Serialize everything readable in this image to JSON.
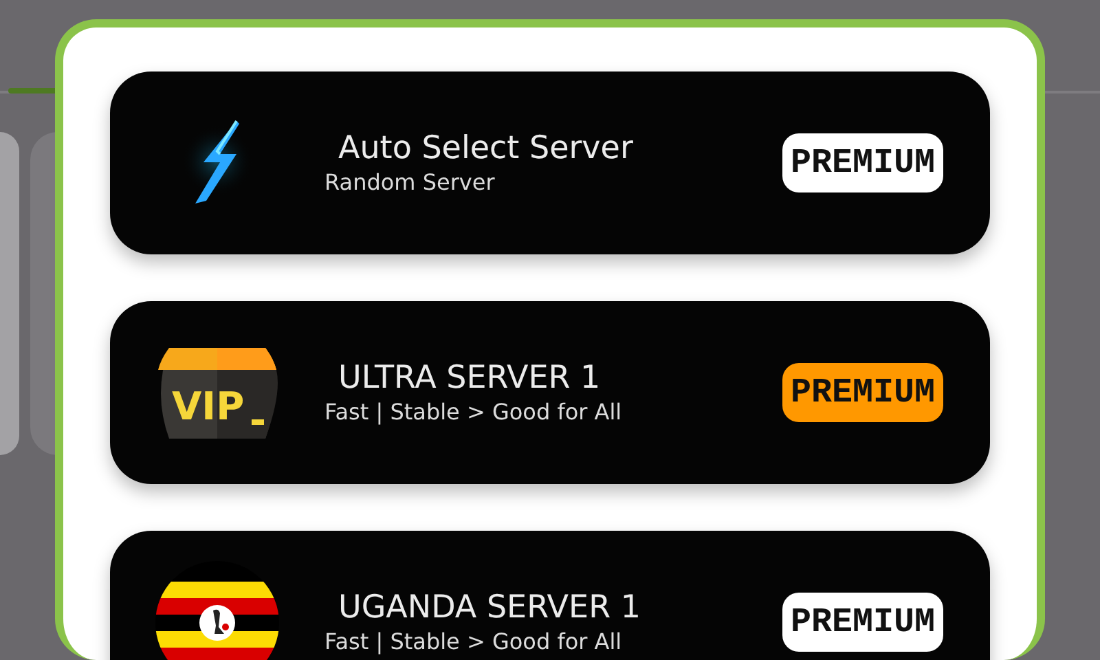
{
  "servers": [
    {
      "kind": "bolt",
      "title": "Auto Select Server",
      "subtitle": "Random Server",
      "badge": {
        "label": "PREMIUM",
        "color": "#ffffff"
      }
    },
    {
      "kind": "vip",
      "icon_text": "VIP",
      "title": "ULTRA SERVER 1",
      "subtitle": "Fast | Stable > Good for All",
      "badge": {
        "label": "PREMIUM",
        "color": "#ff9800"
      }
    },
    {
      "kind": "uganda-flag",
      "title": "UGANDA SERVER 1",
      "subtitle": "Fast | Stable > Good for All",
      "badge": {
        "label": "PREMIUM",
        "color": "#ffffff"
      }
    }
  ]
}
